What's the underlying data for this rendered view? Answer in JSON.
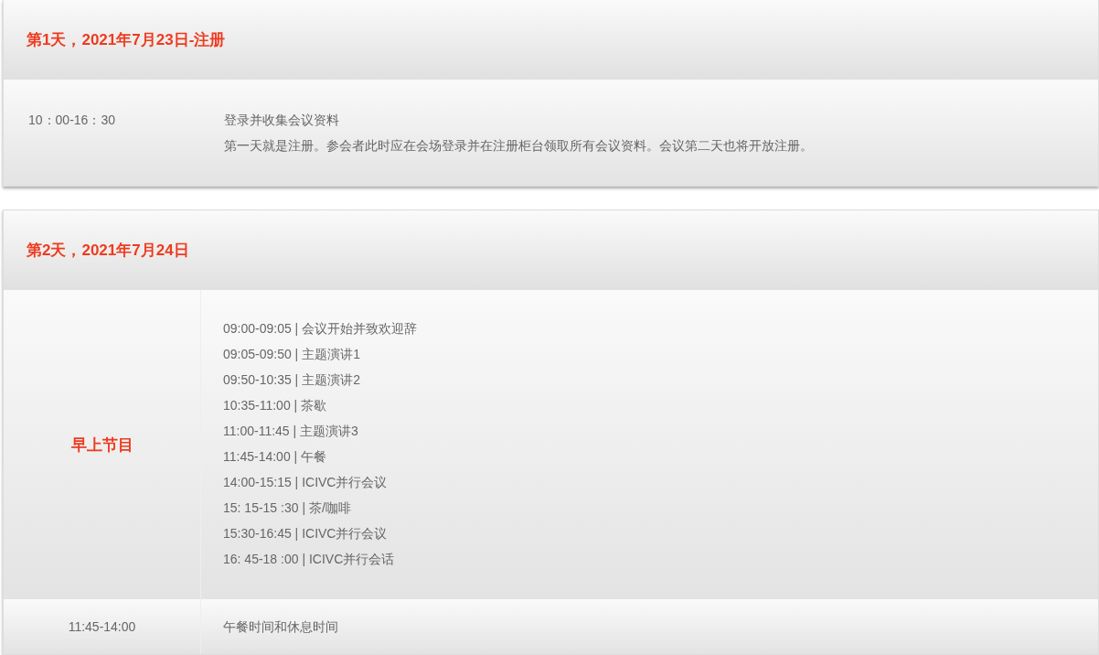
{
  "days": [
    {
      "title": "第1天，2021年7月23日-注册",
      "rows": [
        {
          "kind": "inline",
          "time": "10：00-16：30",
          "lines": [
            "登录并收集会议资料",
            "第一天就是注册。参会者此时应在会场登录并在注册柜台领取所有会议资料。会议第二天也将开放注册。"
          ]
        }
      ]
    },
    {
      "title": "第2天，2021年7月24日",
      "rows": [
        {
          "kind": "program",
          "label": "早上节目",
          "lines": [
            "09:00-09:05 | 会议开始并致欢迎辞",
            "09:05-09:50 | 主题演讲1",
            "09:50-10:35 | 主题演讲2",
            "10:35-11:00 | 茶歇",
            "11:00-11:45 | 主题演讲3",
            "11:45-14:00 | 午餐",
            "14:00-15:15 | ICIVC并行会议",
            "15: 15-15 :30 | 茶/咖啡",
            "15:30-16:45 | ICIVC并行会议",
            "16: 45-18 :00 | ICIVC并行会话"
          ]
        },
        {
          "kind": "timed",
          "time": "11:45-14:00",
          "lines": [
            "午餐时间和休息时间"
          ]
        }
      ]
    }
  ]
}
